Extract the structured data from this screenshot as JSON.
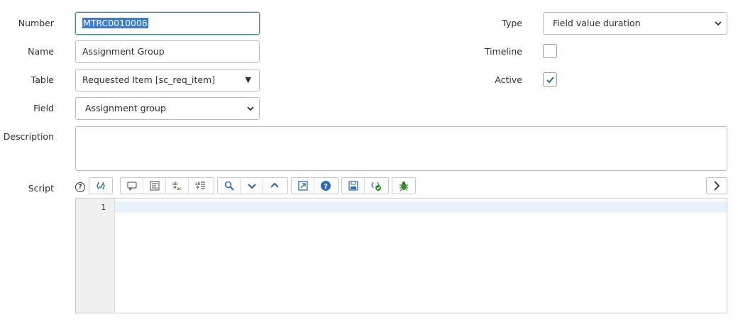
{
  "form": {
    "number_label": "Number",
    "number_value": "MTRC0010006",
    "name_label": "Name",
    "name_value": "Assignment Group",
    "table_label": "Table",
    "table_value": "Requested Item [sc_req_item]",
    "field_label": "Field",
    "field_value": "Assignment group",
    "description_label": "Description",
    "description_value": "",
    "script_label": "Script",
    "type_label": "Type",
    "type_value": "Field value duration",
    "timeline_label": "Timeline",
    "timeline_checked": false,
    "active_label": "Active",
    "active_checked": true
  },
  "editor": {
    "line_numbers": [
      "1"
    ],
    "code": ""
  },
  "toolbar": {
    "help_glyph": "?",
    "groups": [
      [
        "format-code-icon"
      ],
      [
        "comment-icon",
        "align-left-icon",
        "replace-icon",
        "replace-all-icon"
      ],
      [
        "search-icon",
        "next-match-icon",
        "previous-match-icon"
      ],
      [
        "fullscreen-icon",
        "help-icon"
      ],
      [
        "save-icon",
        "syntax-check-icon"
      ],
      [
        "debug-bug-icon"
      ]
    ],
    "expand_icon": "chevron-right-icon"
  },
  "colors": {
    "selection": "#3d7bd0",
    "focus_border": "#4a8a88",
    "check": "#2f6f6c",
    "icon_blue": "#2b6cb8",
    "icon_green": "#3a8a2e"
  }
}
